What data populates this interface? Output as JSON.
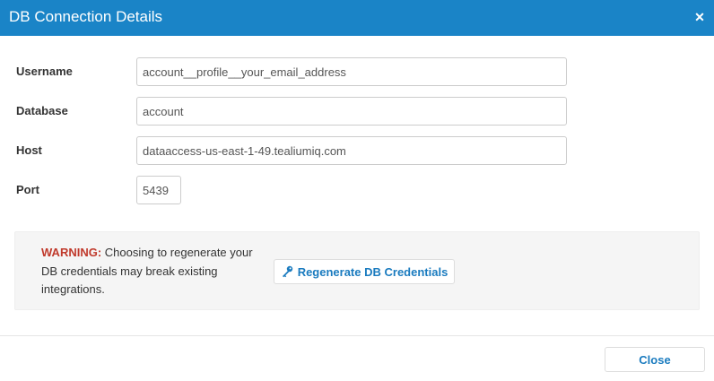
{
  "dialog": {
    "title": "DB Connection Details",
    "close_icon_glyph": "✕"
  },
  "fields": {
    "username": {
      "label": "Username",
      "value": "account__profile__your_email_address"
    },
    "database": {
      "label": "Database",
      "value": "account"
    },
    "host": {
      "label": "Host",
      "value": "dataaccess-us-east-1-49.tealiumiq.com"
    },
    "port": {
      "label": "Port",
      "value": "5439"
    }
  },
  "warning": {
    "prefix": "WARNING:",
    "message": " Choosing to regenerate your DB credentials may break existing integrations."
  },
  "regenerate_button": {
    "label": "Regenerate DB Credentials",
    "icon": "key-icon"
  },
  "footer": {
    "close_label": "Close"
  },
  "colors": {
    "header": "#1a84c7",
    "accent": "#1a7bbf",
    "warning": "#c0392b"
  }
}
